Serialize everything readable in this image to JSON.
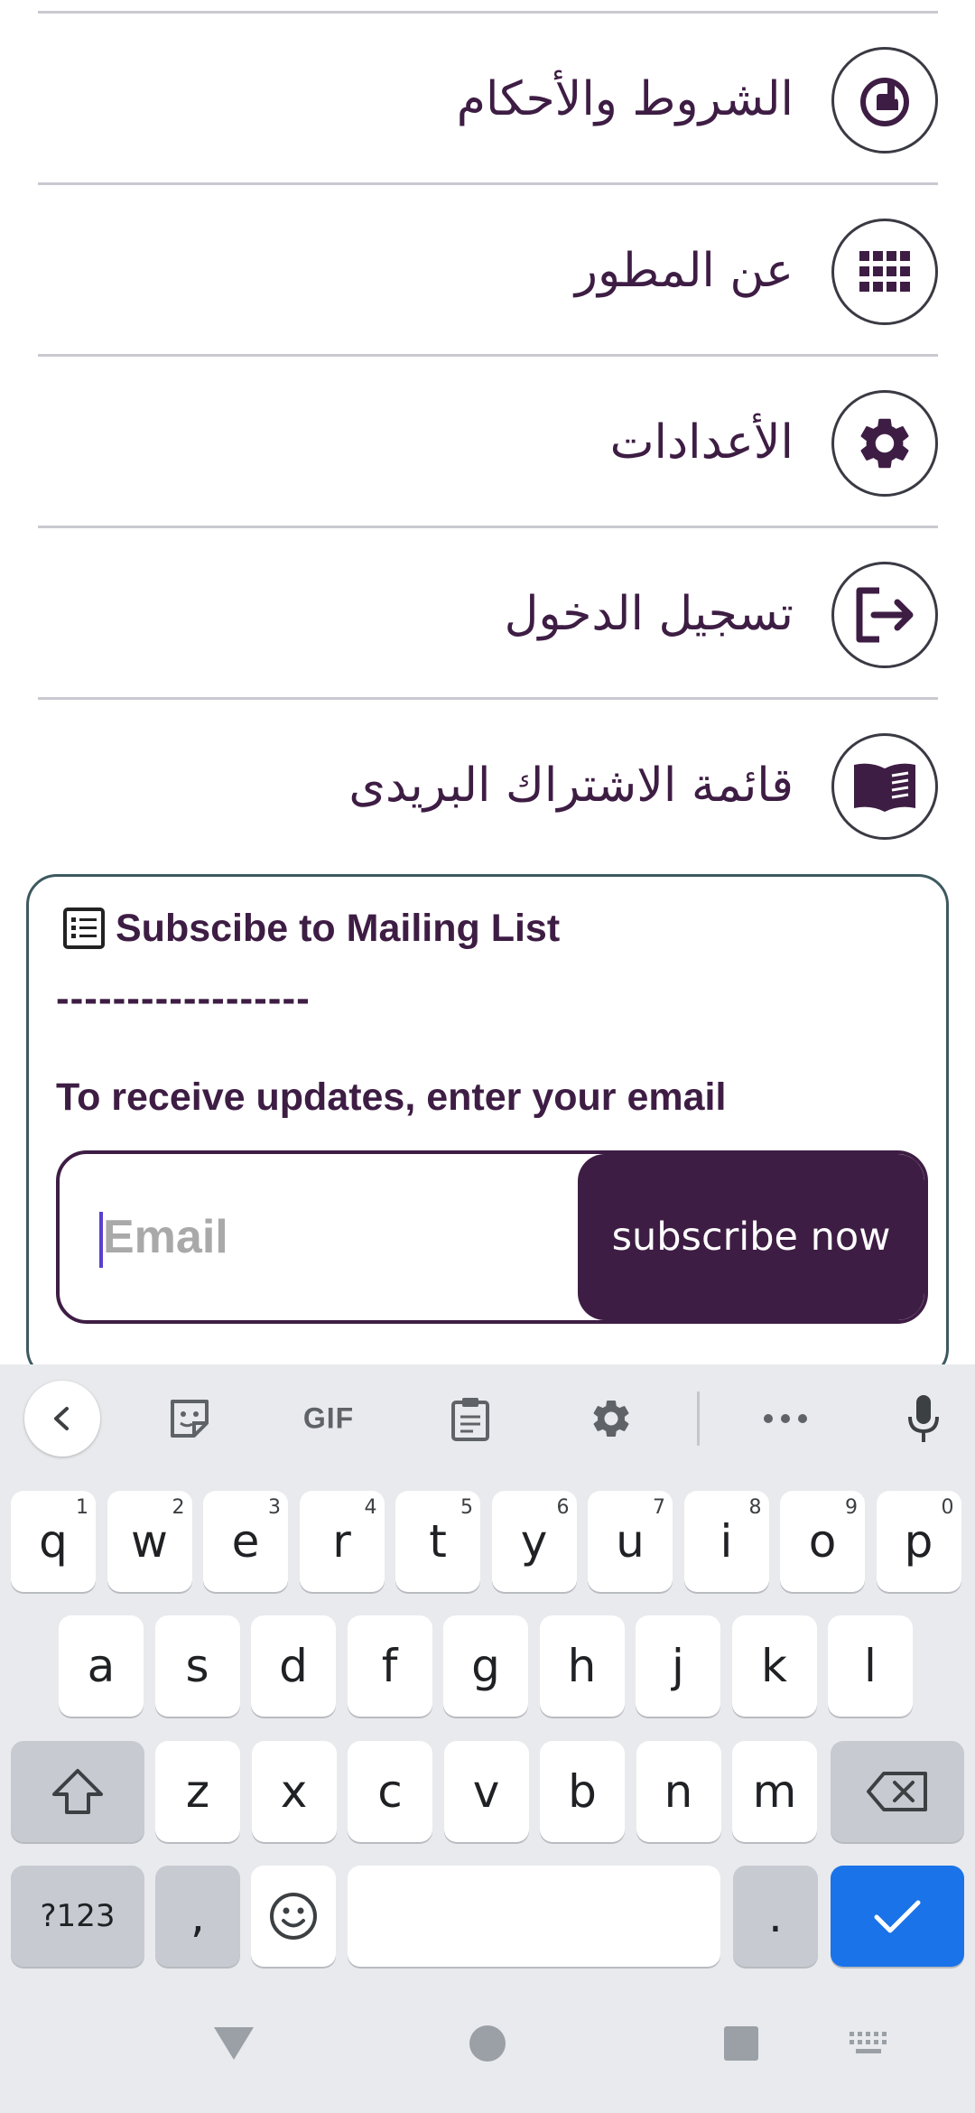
{
  "menu": {
    "items": [
      {
        "label": "الشروط والأحكام",
        "icon": "hand-pointer-icon"
      },
      {
        "label": "عن المطور",
        "icon": "grid-dots-icon"
      },
      {
        "label": "الأعدادات",
        "icon": "gear-icon"
      },
      {
        "label": "تسجيل الدخول",
        "icon": "login-arrow-icon"
      },
      {
        "label": "قائمة الاشتراك البريدى",
        "icon": "open-book-icon"
      }
    ]
  },
  "subscribe": {
    "title": "Subscibe to Mailing List",
    "dashes": "------------------",
    "description": "To receive updates, enter your email",
    "email_placeholder": "Email",
    "email_value": "",
    "button_label": "subscribe now"
  },
  "keyboard": {
    "toolbar": {
      "gif_label": "GIF",
      "icons": [
        "chevron-left-icon",
        "sticker-icon",
        "gif-icon",
        "clipboard-icon",
        "settings-gear-icon",
        "more-icon",
        "microphone-icon"
      ]
    },
    "row1": [
      {
        "k": "q",
        "h": "1"
      },
      {
        "k": "w",
        "h": "2"
      },
      {
        "k": "e",
        "h": "3"
      },
      {
        "k": "r",
        "h": "4"
      },
      {
        "k": "t",
        "h": "5"
      },
      {
        "k": "y",
        "h": "6"
      },
      {
        "k": "u",
        "h": "7"
      },
      {
        "k": "i",
        "h": "8"
      },
      {
        "k": "o",
        "h": "9"
      },
      {
        "k": "p",
        "h": "0"
      }
    ],
    "row2": [
      "a",
      "s",
      "d",
      "f",
      "g",
      "h",
      "j",
      "k",
      "l"
    ],
    "row3": [
      "z",
      "x",
      "c",
      "v",
      "b",
      "n",
      "m"
    ],
    "sym_label": "?123",
    "comma": ",",
    "period": "."
  },
  "colors": {
    "brand": "#3e1d44",
    "card_border": "#3d5960",
    "keyboard_bg": "#e8eaed",
    "enter_key": "#1a73e8"
  }
}
